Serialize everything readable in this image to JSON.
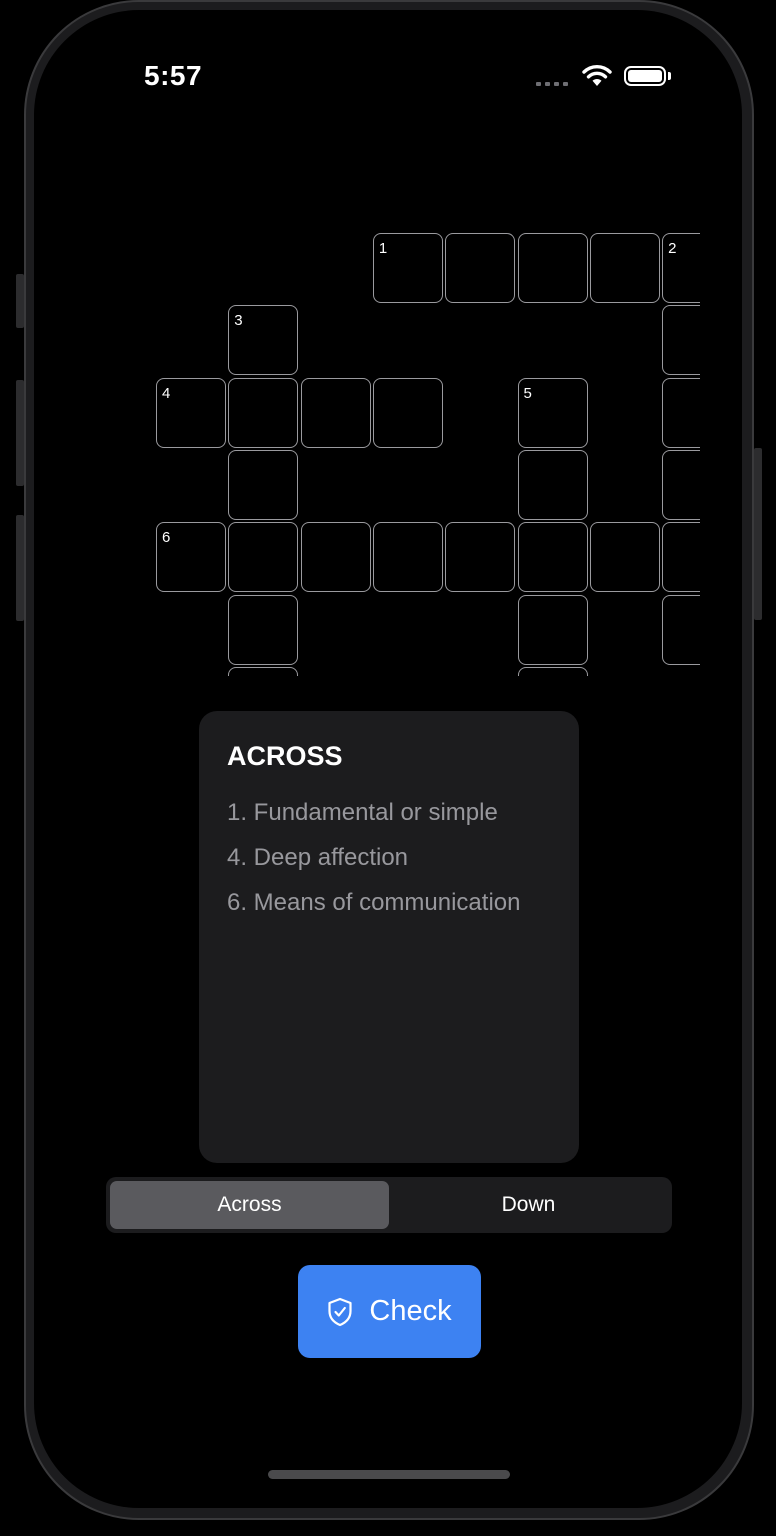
{
  "status_bar": {
    "time": "5:57"
  },
  "crossword": {
    "cells": [
      {
        "row": 0,
        "col": 3,
        "number": "1"
      },
      {
        "row": 0,
        "col": 4,
        "number": ""
      },
      {
        "row": 0,
        "col": 5,
        "number": ""
      },
      {
        "row": 0,
        "col": 6,
        "number": ""
      },
      {
        "row": 0,
        "col": 7,
        "number": "2"
      },
      {
        "row": 1,
        "col": 1,
        "number": "3"
      },
      {
        "row": 1,
        "col": 7,
        "number": ""
      },
      {
        "row": 2,
        "col": 0,
        "number": "4"
      },
      {
        "row": 2,
        "col": 1,
        "number": ""
      },
      {
        "row": 2,
        "col": 2,
        "number": ""
      },
      {
        "row": 2,
        "col": 3,
        "number": ""
      },
      {
        "row": 2,
        "col": 5,
        "number": "5"
      },
      {
        "row": 2,
        "col": 7,
        "number": ""
      },
      {
        "row": 3,
        "col": 1,
        "number": ""
      },
      {
        "row": 3,
        "col": 5,
        "number": ""
      },
      {
        "row": 3,
        "col": 7,
        "number": ""
      },
      {
        "row": 4,
        "col": 0,
        "number": "6"
      },
      {
        "row": 4,
        "col": 1,
        "number": ""
      },
      {
        "row": 4,
        "col": 2,
        "number": ""
      },
      {
        "row": 4,
        "col": 3,
        "number": ""
      },
      {
        "row": 4,
        "col": 4,
        "number": ""
      },
      {
        "row": 4,
        "col": 5,
        "number": ""
      },
      {
        "row": 4,
        "col": 6,
        "number": ""
      },
      {
        "row": 4,
        "col": 7,
        "number": ""
      },
      {
        "row": 5,
        "col": 1,
        "number": ""
      },
      {
        "row": 5,
        "col": 5,
        "number": ""
      },
      {
        "row": 5,
        "col": 7,
        "number": ""
      },
      {
        "row": 6,
        "col": 1,
        "number": ""
      },
      {
        "row": 6,
        "col": 5,
        "number": ""
      }
    ]
  },
  "clues": {
    "title": "ACROSS",
    "items": [
      "1. Fundamental or simple",
      "4. Deep affection",
      "6. Means of communication"
    ]
  },
  "segmented": {
    "across_label": "Across",
    "down_label": "Down",
    "selected": "Across"
  },
  "check_button": {
    "label": "Check",
    "icon": "shield-check-icon",
    "color": "#3d82f2"
  }
}
